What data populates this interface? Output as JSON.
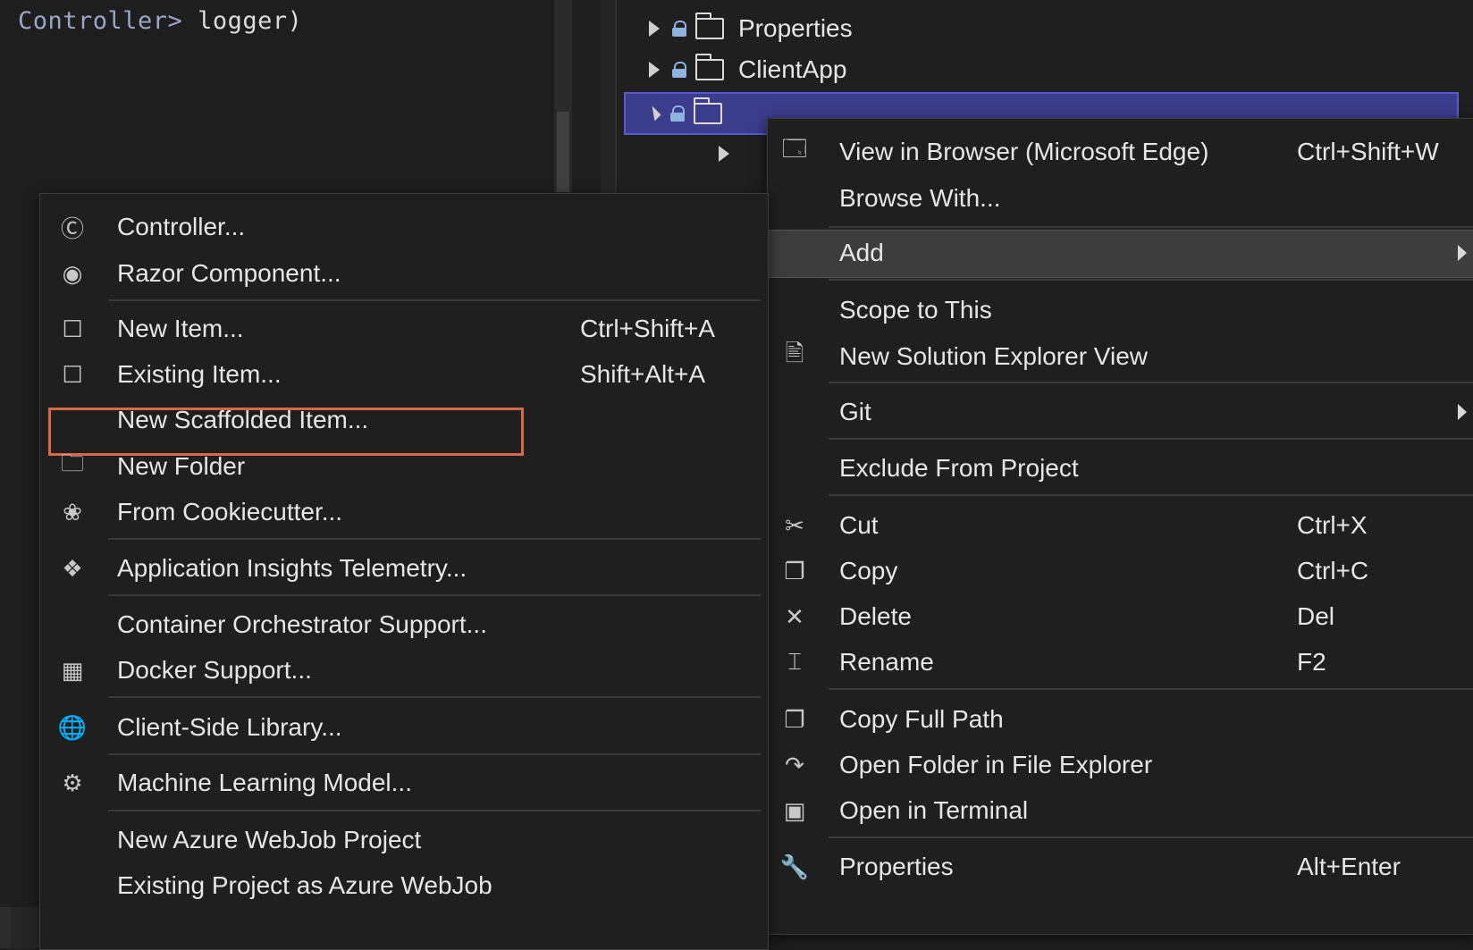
{
  "editor": {
    "code_type": "Controller>",
    "code_ident": "logger)"
  },
  "solution_explorer": {
    "items": [
      {
        "label": "Properties",
        "expanded": false,
        "icon": "properties-folder-icon"
      },
      {
        "label": "ClientApp",
        "expanded": false,
        "icon": "folder-icon"
      },
      {
        "label": "",
        "expanded": true,
        "icon": "open-folder-icon",
        "selected": true
      }
    ]
  },
  "context_menu": {
    "items": [
      {
        "label": "View in Browser (Microsoft Edge)",
        "shortcut": "Ctrl+Shift+W",
        "icon": "view-in-browser-icon"
      },
      {
        "label": "Browse With...",
        "shortcut": "",
        "icon": ""
      },
      {
        "label": "Add",
        "shortcut": "",
        "icon": "",
        "submenu": true,
        "highlighted": true
      },
      {
        "label": "Scope to This",
        "shortcut": "",
        "icon": ""
      },
      {
        "label": "New Solution Explorer View",
        "shortcut": "",
        "icon": "new-solution-explorer-view-icon"
      },
      {
        "label": "Git",
        "shortcut": "",
        "icon": "",
        "submenu": true
      },
      {
        "label": "Exclude From Project",
        "shortcut": "",
        "icon": ""
      },
      {
        "label": "Cut",
        "shortcut": "Ctrl+X",
        "icon": "scissors-icon"
      },
      {
        "label": "Copy",
        "shortcut": "Ctrl+C",
        "icon": "copy-icon"
      },
      {
        "label": "Delete",
        "shortcut": "Del",
        "icon": "delete-x-icon"
      },
      {
        "label": "Rename",
        "shortcut": "F2",
        "icon": "rename-icon"
      },
      {
        "label": "Copy Full Path",
        "shortcut": "",
        "icon": "copy-icon"
      },
      {
        "label": "Open Folder in File Explorer",
        "shortcut": "",
        "icon": "open-folder-arrow-icon"
      },
      {
        "label": "Open in Terminal",
        "shortcut": "",
        "icon": "terminal-icon"
      },
      {
        "label": "Properties",
        "shortcut": "Alt+Enter",
        "icon": "wrench-icon"
      }
    ]
  },
  "add_submenu": {
    "items": [
      {
        "label": "Controller...",
        "shortcut": "",
        "icon": "controller-icon"
      },
      {
        "label": "Razor Component...",
        "shortcut": "",
        "icon": "razor-component-icon"
      },
      {
        "label": "New Item...",
        "shortcut": "Ctrl+Shift+A",
        "icon": "new-item-icon"
      },
      {
        "label": "Existing Item...",
        "shortcut": "Shift+Alt+A",
        "icon": "existing-item-icon"
      },
      {
        "label": "New Scaffolded Item...",
        "shortcut": "",
        "icon": "",
        "outlined": true
      },
      {
        "label": "New Folder",
        "shortcut": "",
        "icon": "new-folder-icon"
      },
      {
        "label": "From Cookiecutter...",
        "shortcut": "",
        "icon": "cookiecutter-icon"
      },
      {
        "label": "Application Insights Telemetry...",
        "shortcut": "",
        "icon": "application-insights-icon"
      },
      {
        "label": "Container Orchestrator Support...",
        "shortcut": "",
        "icon": ""
      },
      {
        "label": "Docker Support...",
        "shortcut": "",
        "icon": "docker-icon"
      },
      {
        "label": "Client-Side Library...",
        "shortcut": "",
        "icon": "client-side-library-icon"
      },
      {
        "label": "Machine Learning Model...",
        "shortcut": "",
        "icon": "machine-learning-icon"
      },
      {
        "label": "New Azure WebJob Project",
        "shortcut": "",
        "icon": ""
      },
      {
        "label": "Existing Project as Azure WebJob",
        "shortcut": "",
        "icon": ""
      }
    ]
  },
  "colors": {
    "background": "#1e1e1e",
    "menu_background": "#1f1f1f",
    "selection": "#3c3c8c",
    "highlight": "#3d3d3d",
    "outline": "#d8684a"
  }
}
